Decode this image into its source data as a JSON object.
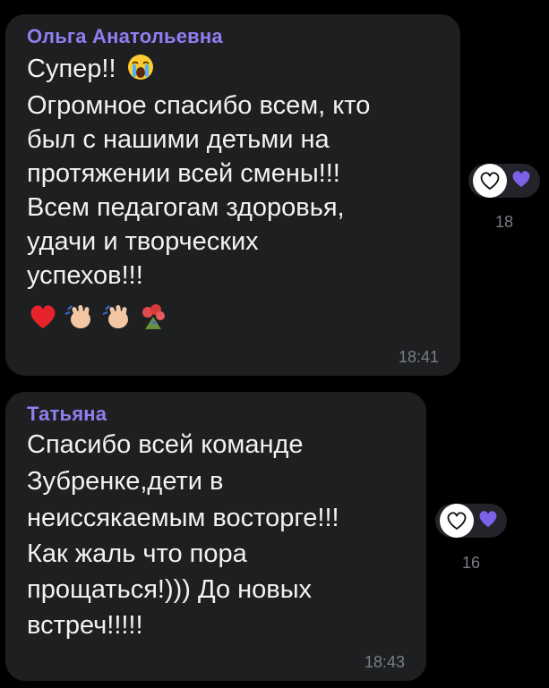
{
  "messages": [
    {
      "sender": "Ольга Анатольевна",
      "lines": [
        "Супер!!",
        "Огромное спасибо всем, кто",
        "был с нашими детьми на",
        "протяжении всей смены!!!",
        "Всем  педагогам здоровья,",
        "удачи и творческих",
        "успехов!!!"
      ],
      "time": "18:41",
      "inline_emoji": "loudly-crying-face",
      "emoji_row": [
        "red-heart",
        "waving-hand",
        "waving-hand",
        "bouquet"
      ],
      "reaction_count": "18"
    },
    {
      "sender": "Татьяна",
      "lines": [
        "Спасибо всей команде",
        "Зубренке,дети в",
        "неиссякаемым восторге!!!",
        "Как жаль что пора",
        "прощаться!))) До новых",
        "встреч!!!!!"
      ],
      "time": "18:43",
      "reaction_count": "16"
    }
  ],
  "colors": {
    "background": "#000000",
    "bubble": "#1e1f21",
    "sender_name": "#8f7ff0",
    "text": "#f2f2f2",
    "meta": "#7a7d83",
    "reaction_heart": "#7b62e6"
  }
}
